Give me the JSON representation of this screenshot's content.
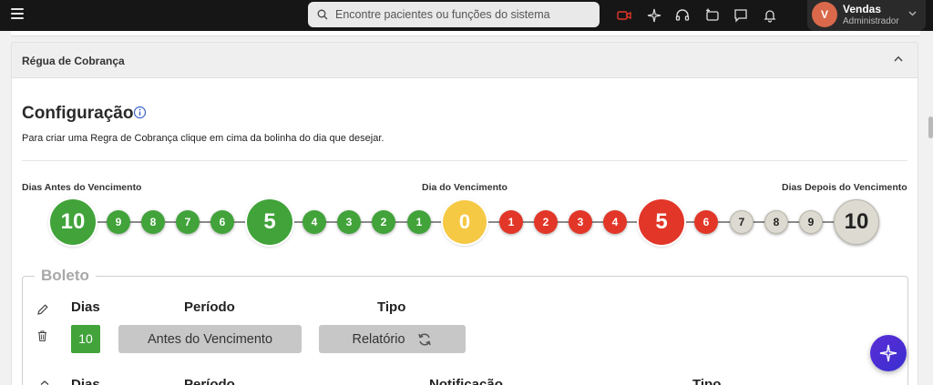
{
  "topbar": {
    "search_placeholder": "Encontre pacientes ou funções do sistema",
    "user_initial": "V",
    "user_name": "Vendas",
    "user_role": "Administrador"
  },
  "section": {
    "title": "Régua de Cobrança"
  },
  "config": {
    "title": "Configuração",
    "description": "Para criar uma Regra de Cobrança clique em cima da bolinha do dia que desejar.",
    "label_before": "Dias Antes do Vencimento",
    "label_due": "Dia do Vencimento",
    "label_after": "Dias Depois do Vencimento"
  },
  "colors": {
    "green": "#41a33a",
    "yellow": "#f6c945",
    "red": "#e23628",
    "grey": "#dcdad1",
    "accent": "#4b30d6"
  },
  "timeline": [
    {
      "label": "10",
      "kind": "green",
      "size": "large"
    },
    {
      "label": "9",
      "kind": "green",
      "size": "small"
    },
    {
      "label": "8",
      "kind": "green",
      "size": "small"
    },
    {
      "label": "7",
      "kind": "green",
      "size": "small"
    },
    {
      "label": "6",
      "kind": "green",
      "size": "small"
    },
    {
      "label": "5",
      "kind": "green",
      "size": "large"
    },
    {
      "label": "4",
      "kind": "green",
      "size": "small"
    },
    {
      "label": "3",
      "kind": "green",
      "size": "small"
    },
    {
      "label": "2",
      "kind": "green",
      "size": "small"
    },
    {
      "label": "1",
      "kind": "green",
      "size": "small"
    },
    {
      "label": "0",
      "kind": "yellow",
      "size": "medium"
    },
    {
      "label": "1",
      "kind": "red",
      "size": "small"
    },
    {
      "label": "2",
      "kind": "red",
      "size": "small"
    },
    {
      "label": "3",
      "kind": "red",
      "size": "small"
    },
    {
      "label": "4",
      "kind": "red",
      "size": "small"
    },
    {
      "label": "5",
      "kind": "red",
      "size": "large"
    },
    {
      "label": "6",
      "kind": "red",
      "size": "small"
    },
    {
      "label": "7",
      "kind": "grey",
      "size": "small"
    },
    {
      "label": "8",
      "kind": "grey",
      "size": "small"
    },
    {
      "label": "9",
      "kind": "grey",
      "size": "small"
    },
    {
      "label": "10",
      "kind": "grey",
      "size": "large"
    }
  ],
  "boleto": {
    "legend": "Boleto",
    "col_dias": "Dias",
    "col_periodo": "Período",
    "col_tipo": "Tipo",
    "row_days": "10",
    "row_period": "Antes do Vencimento",
    "row_type": "Relatório",
    "col2_dias": "Dias",
    "col2_periodo": "Período",
    "col2_notificacao": "Notificação",
    "col2_tipo": "Tipo"
  }
}
